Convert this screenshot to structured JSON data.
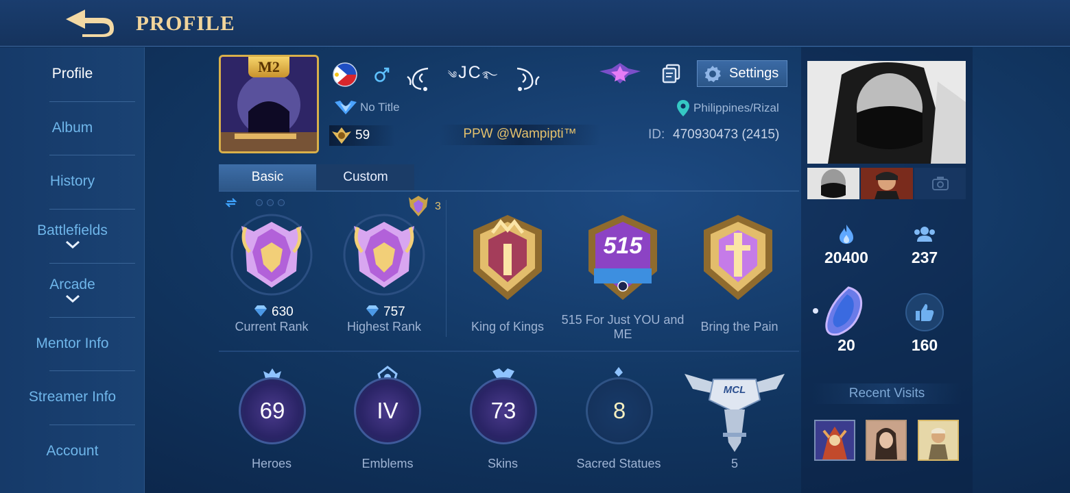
{
  "header": {
    "title": "PROFILE"
  },
  "sidebar": {
    "items": [
      {
        "label": "Profile",
        "active": true
      },
      {
        "label": "Album"
      },
      {
        "label": "History"
      },
      {
        "label": "Battlefields",
        "expandable": true
      },
      {
        "label": "Arcade",
        "expandable": true
      },
      {
        "label": "Mentor Info"
      },
      {
        "label": "Streamer Info"
      },
      {
        "label": "Account"
      }
    ]
  },
  "profile": {
    "frame_badge": "M2",
    "player_name": "JC",
    "title": "No Title",
    "level": "59",
    "squad": "PPW @Wampipti™",
    "location": "Philippines/Rizal",
    "id_label": "ID:",
    "id_value": "470930473 (2415)",
    "settings_label": "Settings"
  },
  "tabs": [
    {
      "label": "Basic",
      "active": true
    },
    {
      "label": "Custom"
    }
  ],
  "ranks": {
    "badge_count": "3",
    "current": {
      "value": "630",
      "label": "Current Rank"
    },
    "highest": {
      "value": "757",
      "label": "Highest Rank"
    },
    "achievements": [
      {
        "label": "King of Kings"
      },
      {
        "label": "515 For Just YOU and ME",
        "badge_text": "515"
      },
      {
        "label": "Bring the Pain"
      }
    ]
  },
  "collection": {
    "heroes": {
      "value": "69",
      "label": "Heroes"
    },
    "emblems": {
      "value": "IV",
      "label": "Emblems"
    },
    "skins": {
      "value": "73",
      "label": "Skins"
    },
    "statues": {
      "value": "8",
      "label": "Sacred Statues"
    },
    "mcl": {
      "value": "5",
      "badge_text": "MCL"
    }
  },
  "side_stats": {
    "popularity": "20400",
    "friends": "237",
    "charm": "20",
    "likes": "160",
    "recent_visits_label": "Recent Visits"
  },
  "colors": {
    "accent_gold": "#f1d49b",
    "sidebar_text": "#6fb6ea",
    "squad_gold": "#e4c16d"
  }
}
